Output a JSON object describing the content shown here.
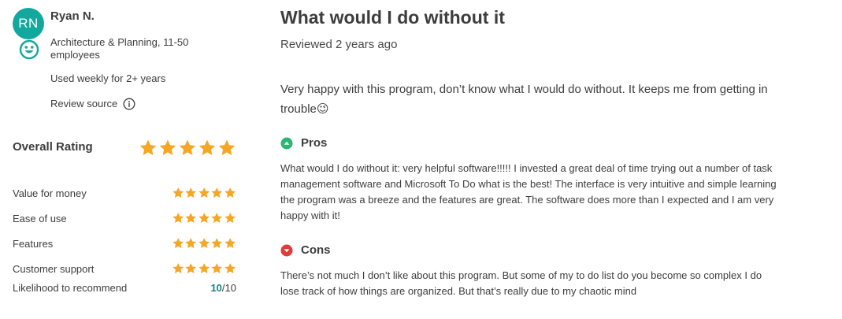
{
  "reviewer": {
    "initials": "RN",
    "name": "Ryan N.",
    "company": "Architecture & Planning, 11-50 employees",
    "usage": "Used weekly for 2+ years",
    "source_label": "Review source",
    "avatar_color": "#13a89e"
  },
  "ratings": {
    "overall_label": "Overall Rating",
    "overall_stars": 5,
    "items": [
      {
        "label": "Value for money",
        "stars": 5
      },
      {
        "label": "Ease of use",
        "stars": 5
      },
      {
        "label": "Features",
        "stars": 5
      },
      {
        "label": "Customer support",
        "stars": 5
      }
    ],
    "likelihood_label": "Likelihood to recommend",
    "likelihood_value": "10",
    "likelihood_max": "/10",
    "star_color": "#f5a623"
  },
  "review": {
    "title": "What would I do without it",
    "reviewed": "Reviewed 2 years ago",
    "summary": "Very happy with this program, don’t know what I would do without. It keeps me from getting in trouble",
    "summary_emoji": "😉",
    "pros_label": "Pros",
    "pros_text": "What would I do without it: very helpful software!!!!! I invested a great deal of time trying out a number of task management software and Microsoft To Do what is the best! The interface is very intuitive and simple learning the program was a breeze and the features are great. The software does more than I expected and I am very happy with it!",
    "cons_label": "Cons",
    "cons_text": "There’s not much I don’t like about this program. But some of my to do list do you become so complex I do lose track of how things are organized. But that’s really due to my chaotic mind",
    "pros_color": "#2bb673",
    "cons_color": "#e03c3c"
  }
}
